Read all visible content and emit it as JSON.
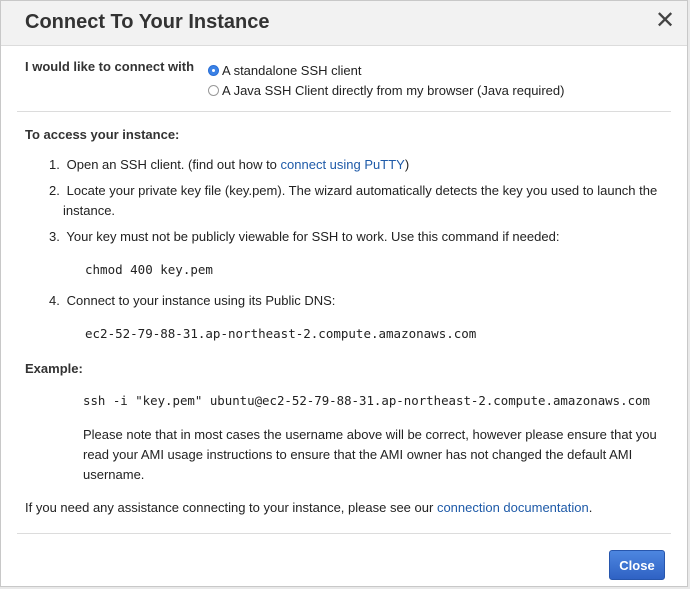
{
  "dialog": {
    "title": "Connect To Your Instance",
    "close_icon": "close-icon"
  },
  "connect_with": {
    "label": "I would like to connect with",
    "options": [
      {
        "label": "A standalone SSH client",
        "checked": true
      },
      {
        "label": "A Java SSH Client directly from my browser (Java required)",
        "checked": false
      }
    ]
  },
  "access": {
    "heading": "To access your instance:",
    "steps": [
      {
        "num": "1.",
        "text": "Open an SSH client. (find out how to ",
        "link": "connect using PuTTY",
        "after": ")"
      },
      {
        "num": "2.",
        "text": "Locate your private key file (key.pem). The wizard automatically detects the key you used to launch the",
        "cont": "instance."
      },
      {
        "num": "3.",
        "text": "Your key must not be publicly viewable for SSH to work. Use this command if needed:"
      },
      {
        "num": "4.",
        "text": "Connect to your instance using its Public DNS:"
      }
    ],
    "chmod_command": "chmod 400 key.pem",
    "public_dns": "ec2-52-79-88-31.ap-northeast-2.compute.amazonaws.com"
  },
  "example": {
    "heading": "Example:",
    "command": "ssh -i \"key.pem\" ubuntu@ec2-52-79-88-31.ap-northeast-2.compute.amazonaws.com",
    "note_lines": [
      "Please note that in most cases the username above will be correct, however please ensure that you",
      "read your AMI usage instructions to ensure that the AMI owner has not changed the default AMI",
      "username."
    ]
  },
  "assistance": {
    "text": "If you need any assistance connecting to your instance, please see our ",
    "link": "connection documentation",
    "after": "."
  },
  "footer": {
    "close_label": "Close"
  },
  "colors": {
    "link": "#1e5aa8",
    "primary_button": "#2f62c4",
    "radio_checked": "#3b82e6"
  }
}
